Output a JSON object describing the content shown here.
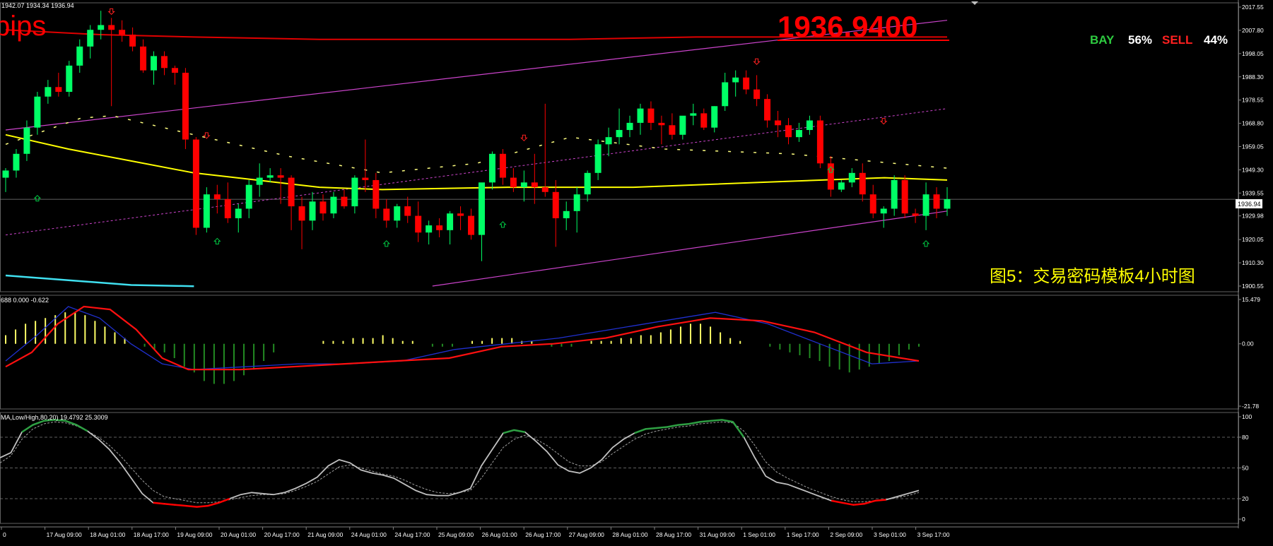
{
  "header": {
    "ohlc_text": "1942.07 1934.34 1936.94",
    "pips_fragment": "pips",
    "big_price": "1936.9400",
    "bay_label": "BAY",
    "bay_pct": "56%",
    "sell_label": "SELL",
    "sell_pct": "44%",
    "caption": "图5：交易密码模板4小时图",
    "current_price_tag": "1936.94"
  },
  "colors": {
    "background": "#000000",
    "bull_candle": "#00ff66",
    "bear_candle": "#ff0000",
    "ma_yellow": "#ffff00",
    "ma_red": "#e00000",
    "ma_cyan": "#40e0f0",
    "channel": "#cc44cc",
    "macd_pos": "#ffff66",
    "macd_neg": "#228B22",
    "stoch_main": "#c0c0c0",
    "stoch_hot_up": "#2ea043",
    "stoch_hot_down": "#ff0000"
  },
  "chart_data": [
    {
      "type": "candlestick",
      "panel": "price",
      "ylim": [
        1900.55,
        2017.55
      ],
      "y_ticks": [
        "2017.55",
        "2007.80",
        "1998.05",
        "1988.30",
        "1978.55",
        "1968.80",
        "1959.05",
        "1949.30",
        "1939.55",
        "1929.98",
        "1920.05",
        "1910.30",
        "1900.55"
      ],
      "x_ticks": [
        "0",
        "17 Aug 09:00",
        "18 Aug 01:00",
        "18 Aug 17:00",
        "19 Aug 09:00",
        "20 Aug 01:00",
        "20 Aug 17:00",
        "21 Aug 09:00",
        "24 Aug 01:00",
        "24 Aug 17:00",
        "25 Aug 09:00",
        "26 Aug 01:00",
        "26 Aug 17:00",
        "27 Aug 09:00",
        "28 Aug 01:00",
        "28 Aug 17:00",
        "31 Aug 09:00",
        "1 Sep 01:00",
        "1 Sep 17:00",
        "2 Sep 09:00",
        "3 Sep 01:00",
        "3 Sep 17:00"
      ],
      "current_price": 1936.94,
      "candles": [
        [
          1946,
          1950,
          1940,
          1949
        ],
        [
          1949,
          1958,
          1946,
          1956
        ],
        [
          1956,
          1970,
          1953,
          1967
        ],
        [
          1967,
          1982,
          1964,
          1980
        ],
        [
          1980,
          1987,
          1977,
          1984
        ],
        [
          1984,
          1990,
          1980,
          1982
        ],
        [
          1982,
          1995,
          1980,
          1993
        ],
        [
          1993,
          2004,
          1990,
          2001
        ],
        [
          2001,
          2010,
          1996,
          2008
        ],
        [
          2008,
          2016,
          2004,
          2010
        ],
        [
          2010,
          2013,
          1976,
          2008
        ],
        [
          2008,
          2012,
          2003,
          2006
        ],
        [
          2006,
          2009,
          1999,
          2001
        ],
        [
          2001,
          2004,
          1990,
          1991
        ],
        [
          1991,
          1999,
          1985,
          1997
        ],
        [
          1997,
          1999,
          1989,
          1992
        ],
        [
          1992,
          1993,
          1985,
          1990
        ],
        [
          1990,
          1992,
          1958,
          1962
        ],
        [
          1962,
          1963,
          1922,
          1925
        ],
        [
          1925,
          1942,
          1923,
          1939
        ],
        [
          1939,
          1943,
          1931,
          1937
        ],
        [
          1937,
          1944,
          1927,
          1929
        ],
        [
          1929,
          1935,
          1923,
          1933
        ],
        [
          1933,
          1945,
          1929,
          1943
        ],
        [
          1943,
          1952,
          1938,
          1946
        ],
        [
          1946,
          1950,
          1944,
          1947
        ],
        [
          1947,
          1950,
          1935,
          1946
        ],
        [
          1946,
          1947,
          1924,
          1934
        ],
        [
          1934,
          1938,
          1916,
          1928
        ],
        [
          1928,
          1940,
          1924,
          1936
        ],
        [
          1936,
          1939,
          1928,
          1931
        ],
        [
          1931,
          1940,
          1929,
          1938
        ],
        [
          1938,
          1941,
          1933,
          1934
        ],
        [
          1934,
          1947,
          1931,
          1946
        ],
        [
          1946,
          1962,
          1940,
          1945
        ],
        [
          1945,
          1948,
          1929,
          1933
        ],
        [
          1933,
          1937,
          1925,
          1928
        ],
        [
          1928,
          1935,
          1925,
          1934
        ],
        [
          1934,
          1938,
          1927,
          1930
        ],
        [
          1930,
          1936,
          1919,
          1923
        ],
        [
          1923,
          1928,
          1918,
          1926
        ],
        [
          1926,
          1929,
          1921,
          1924
        ],
        [
          1924,
          1932,
          1918,
          1931
        ],
        [
          1931,
          1934,
          1924,
          1930
        ],
        [
          1930,
          1933,
          1920,
          1922
        ],
        [
          1922,
          1943,
          1911,
          1944
        ],
        [
          1944,
          1957,
          1941,
          1956
        ],
        [
          1956,
          1958,
          1943,
          1946
        ],
        [
          1946,
          1950,
          1940,
          1942
        ],
        [
          1942,
          1949,
          1936,
          1944
        ],
        [
          1944,
          1956,
          1935,
          1942
        ],
        [
          1942,
          1977,
          1938,
          1940
        ],
        [
          1940,
          1945,
          1917,
          1929
        ],
        [
          1929,
          1936,
          1924,
          1932
        ],
        [
          1932,
          1942,
          1923,
          1939
        ],
        [
          1939,
          1949,
          1936,
          1948
        ],
        [
          1948,
          1962,
          1945,
          1960
        ],
        [
          1960,
          1967,
          1955,
          1963
        ],
        [
          1963,
          1975,
          1960,
          1966
        ],
        [
          1966,
          1972,
          1963,
          1969
        ],
        [
          1969,
          1977,
          1964,
          1975
        ],
        [
          1975,
          1978,
          1966,
          1969
        ],
        [
          1969,
          1972,
          1960,
          1968
        ],
        [
          1968,
          1973,
          1962,
          1964
        ],
        [
          1964,
          1971,
          1962,
          1972
        ],
        [
          1972,
          1977,
          1968,
          1973
        ],
        [
          1973,
          1975,
          1966,
          1967
        ],
        [
          1967,
          1976,
          1965,
          1976
        ],
        [
          1976,
          1990,
          1974,
          1986
        ],
        [
          1986,
          1991,
          1980,
          1988
        ],
        [
          1988,
          1991,
          1981,
          1983
        ],
        [
          1983,
          1989,
          1976,
          1979
        ],
        [
          1979,
          1981,
          1967,
          1970
        ],
        [
          1970,
          1974,
          1963,
          1968
        ],
        [
          1968,
          1971,
          1960,
          1963
        ],
        [
          1963,
          1969,
          1961,
          1966
        ],
        [
          1966,
          1972,
          1964,
          1970
        ],
        [
          1970,
          1972,
          1950,
          1952
        ],
        [
          1952,
          1955,
          1938,
          1941
        ],
        [
          1941,
          1945,
          1940,
          1944
        ],
        [
          1944,
          1950,
          1942,
          1948
        ],
        [
          1948,
          1952,
          1936,
          1939
        ],
        [
          1939,
          1943,
          1929,
          1931
        ],
        [
          1931,
          1934,
          1925,
          1933
        ],
        [
          1933,
          1947,
          1930,
          1945
        ],
        [
          1945,
          1947,
          1929,
          1931
        ],
        [
          1931,
          1933,
          1927,
          1930
        ],
        [
          1930,
          1944,
          1924,
          1939
        ],
        [
          1939,
          1942,
          1929,
          1933
        ],
        [
          1933,
          1942,
          1930,
          1937
        ]
      ],
      "ma_yellow": [
        [
          0,
          1964
        ],
        [
          10,
          1958
        ],
        [
          20,
          1953
        ],
        [
          30,
          1948
        ],
        [
          40,
          1945
        ],
        [
          50,
          1942
        ],
        [
          60,
          1941
        ],
        [
          80,
          1942
        ],
        [
          100,
          1942
        ],
        [
          120,
          1944
        ],
        [
          140,
          1946
        ],
        [
          150,
          1945
        ]
      ],
      "ma_red": [
        [
          0,
          2008
        ],
        [
          15,
          2006
        ],
        [
          30,
          2005
        ],
        [
          50,
          2004
        ],
        [
          70,
          2004
        ],
        [
          90,
          2004
        ],
        [
          110,
          2005
        ],
        [
          130,
          2005
        ],
        [
          150,
          2005
        ]
      ],
      "ma_cyan": [
        [
          0,
          1905
        ],
        [
          10,
          1903
        ],
        [
          20,
          1901
        ],
        [
          30,
          1900.5
        ]
      ],
      "ma_dash": [
        [
          0,
          1960
        ],
        [
          12,
          1971
        ],
        [
          17,
          1972
        ],
        [
          30,
          1964
        ],
        [
          45,
          1955
        ],
        [
          60,
          1948
        ],
        [
          75,
          1952
        ],
        [
          90,
          1963
        ],
        [
          105,
          1958
        ],
        [
          125,
          1956
        ],
        [
          150,
          1950
        ]
      ],
      "channel_upper": [
        [
          0,
          1966
        ],
        [
          150,
          2012
        ]
      ],
      "channel_mid": [
        [
          0,
          1922
        ],
        [
          150,
          1975
        ]
      ],
      "channel_lower": [
        [
          68,
          1900.55
        ],
        [
          150,
          1932
        ]
      ]
    },
    {
      "type": "macd",
      "panel": "macd",
      "label": "688 0.000 -0.622",
      "ylim": [
        -21.78,
        15.479
      ],
      "y_ticks": [
        "15.479",
        "0.00",
        "-21.78"
      ],
      "histogram": [
        3,
        5,
        7,
        8,
        9,
        10,
        11,
        11,
        10,
        8,
        6,
        4,
        2,
        0,
        -1,
        -2,
        -3,
        -5,
        -8,
        -10,
        -13,
        -14,
        -14,
        -13,
        -11,
        -9,
        -6,
        -3,
        0,
        0,
        0,
        0,
        1,
        1,
        1,
        2,
        2,
        2,
        3,
        2,
        1,
        1,
        0,
        -1,
        -1,
        -1,
        0,
        1,
        1,
        2,
        2,
        2,
        1,
        1,
        0,
        -1,
        -1,
        -1,
        0,
        1,
        1,
        1,
        2,
        2,
        3,
        3,
        4,
        5,
        6,
        7,
        7,
        6,
        4,
        2,
        1,
        0,
        0,
        -1,
        -2,
        -3,
        -4,
        -5,
        -6,
        -8,
        -9,
        -10,
        -9,
        -8,
        -7,
        -6,
        -4,
        -2,
        -1
      ],
      "signal_red": [
        [
          0,
          -8
        ],
        [
          5,
          -3
        ],
        [
          10,
          7
        ],
        [
          15,
          13
        ],
        [
          20,
          12
        ],
        [
          25,
          5
        ],
        [
          30,
          -5
        ],
        [
          35,
          -9
        ],
        [
          45,
          -9
        ],
        [
          55,
          -8
        ],
        [
          65,
          -7
        ],
        [
          75,
          -6
        ],
        [
          85,
          -5
        ],
        [
          95,
          -1
        ],
        [
          105,
          0
        ],
        [
          115,
          2
        ],
        [
          125,
          6
        ],
        [
          135,
          9
        ],
        [
          145,
          8
        ],
        [
          155,
          4
        ],
        [
          165,
          -3
        ],
        [
          175,
          -6
        ]
      ],
      "macd_blue": [
        [
          0,
          -6
        ],
        [
          6,
          3
        ],
        [
          12,
          13
        ],
        [
          18,
          9
        ],
        [
          24,
          0
        ],
        [
          30,
          -7
        ],
        [
          36,
          -9
        ],
        [
          46,
          -8
        ],
        [
          56,
          -7
        ],
        [
          66,
          -7
        ],
        [
          76,
          -6
        ],
        [
          86,
          -2
        ],
        [
          96,
          0
        ],
        [
          106,
          2
        ],
        [
          116,
          5
        ],
        [
          126,
          8
        ],
        [
          136,
          11
        ],
        [
          146,
          7
        ],
        [
          156,
          0
        ],
        [
          166,
          -7
        ],
        [
          175,
          -6
        ]
      ]
    },
    {
      "type": "stochastic",
      "panel": "stoch",
      "label": "MA,Low/High,80,20) 19.4792 25.3009",
      "ylim": [
        0,
        100
      ],
      "y_ticks": [
        "100",
        "80",
        "50",
        "20",
        "0"
      ],
      "levels": [
        80,
        50,
        20
      ],
      "main": [
        60,
        65,
        85,
        92,
        96,
        97,
        96,
        92,
        86,
        78,
        68,
        55,
        40,
        25,
        16,
        15,
        14,
        13,
        12,
        13,
        16,
        20,
        24,
        26,
        25,
        24,
        26,
        30,
        35,
        41,
        52,
        58,
        55,
        48,
        45,
        43,
        40,
        34,
        28,
        24,
        23,
        23,
        26,
        30,
        52,
        68,
        84,
        87,
        85,
        76,
        66,
        53,
        47,
        45,
        50,
        58,
        70,
        78,
        84,
        88,
        89,
        90,
        92,
        93,
        95,
        96,
        97,
        95,
        80,
        60,
        42,
        36,
        34,
        30,
        26,
        22,
        18,
        16,
        14,
        15,
        18,
        19,
        22,
        25,
        28
      ],
      "signal": [
        55,
        62,
        78,
        88,
        93,
        95,
        94,
        91,
        86,
        80,
        72,
        62,
        50,
        38,
        28,
        22,
        20,
        18,
        16,
        16,
        17,
        19,
        21,
        23,
        24,
        24,
        25,
        28,
        32,
        37,
        44,
        51,
        53,
        50,
        47,
        44,
        42,
        38,
        33,
        29,
        26,
        25,
        26,
        28,
        40,
        55,
        70,
        78,
        82,
        78,
        72,
        64,
        56,
        52,
        52,
        56,
        64,
        71,
        78,
        83,
        86,
        88,
        90,
        91,
        93,
        94,
        95,
        94,
        86,
        72,
        56,
        46,
        40,
        35,
        30,
        26,
        22,
        19,
        17,
        17,
        18,
        19,
        21,
        23,
        26
      ]
    }
  ]
}
